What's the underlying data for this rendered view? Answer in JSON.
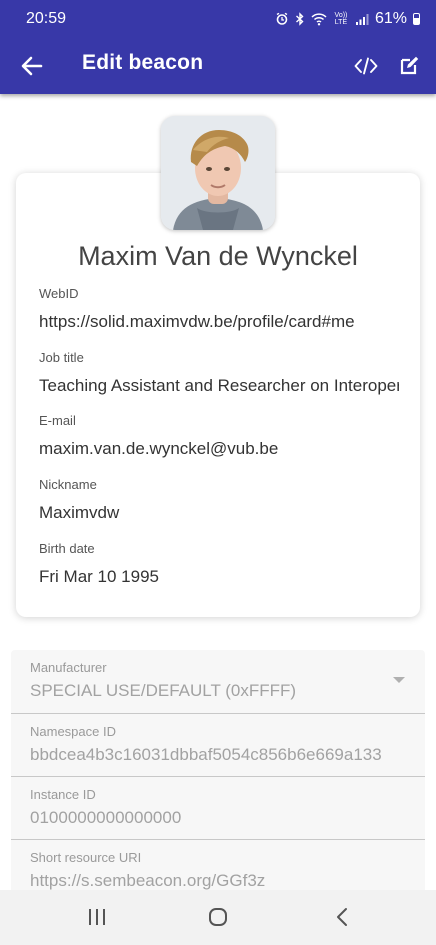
{
  "status_bar": {
    "time": "20:59",
    "battery": "61%",
    "icons": [
      "alarm-icon",
      "bluetooth-icon",
      "wifi-icon",
      "volte-icon",
      "signal-icon",
      "battery-icon"
    ],
    "volte_label": "Vo)) LTE"
  },
  "app_bar": {
    "title": "Edit beacon",
    "background": "#3838a8",
    "icons": [
      "back-arrow-icon",
      "code-icon",
      "edit-square-icon"
    ]
  },
  "profile": {
    "name": "Maxim Van de Wynckel",
    "fields": [
      {
        "label": "WebID",
        "value": "https://solid.maximvdw.be/profile/card#me"
      },
      {
        "label": "Job title",
        "value": "Teaching Assistant and Researcher on Interoperability"
      },
      {
        "label": "E-mail",
        "value": "maxim.van.de.wynckel@vub.be"
      },
      {
        "label": "Nickname",
        "value": "Maximvdw"
      },
      {
        "label": "Birth date",
        "value": "Fri Mar 10 1995"
      }
    ]
  },
  "form": {
    "manufacturer": {
      "label": "Manufacturer",
      "value": "SPECIAL USE/DEFAULT (0xFFFF)"
    },
    "namespace_id": {
      "label": "Namespace ID",
      "value": "bbdcea4b3c16031dbbaf5054c856b6e669a133"
    },
    "instance_id": {
      "label": "Instance ID",
      "value": "0100000000000000"
    },
    "short_uri": {
      "label": "Short resource URI",
      "value": "https://s.sembeacon.org/GGf3z"
    }
  },
  "nav_bar": {
    "icons": [
      "recent-apps-icon",
      "home-icon",
      "back-icon"
    ]
  }
}
